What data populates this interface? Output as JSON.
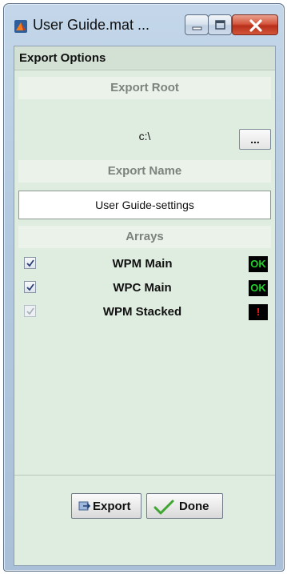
{
  "window": {
    "title": "User Guide.mat ...",
    "app_icon": "matlab-icon",
    "controls": [
      "minimize-icon",
      "maximize-icon",
      "close-icon"
    ]
  },
  "panel": {
    "title": "Export Options"
  },
  "export_root": {
    "header": "Export Root",
    "path": "c:\\",
    "browse_label": "..."
  },
  "export_name": {
    "header": "Export Name",
    "value": "User Guide-settings"
  },
  "arrays": {
    "header": "Arrays",
    "items": [
      {
        "name": "WPM Main",
        "checked": true,
        "enabled": true,
        "status": "OK",
        "status_color": "#21d12a"
      },
      {
        "name": "WPC Main",
        "checked": true,
        "enabled": true,
        "status": "OK",
        "status_color": "#21d12a"
      },
      {
        "name": "WPM Stacked",
        "checked": true,
        "enabled": false,
        "status": "!",
        "status_color": "#ff1a1a"
      }
    ]
  },
  "buttons": {
    "export_label": "Export",
    "export_icon": "export-icon",
    "done_label": "Done",
    "done_icon": "checkmark-icon"
  },
  "colors": {
    "panel_bg": "#dfece0",
    "ok_status": "#21d12a",
    "error_status": "#ff1a1a"
  }
}
